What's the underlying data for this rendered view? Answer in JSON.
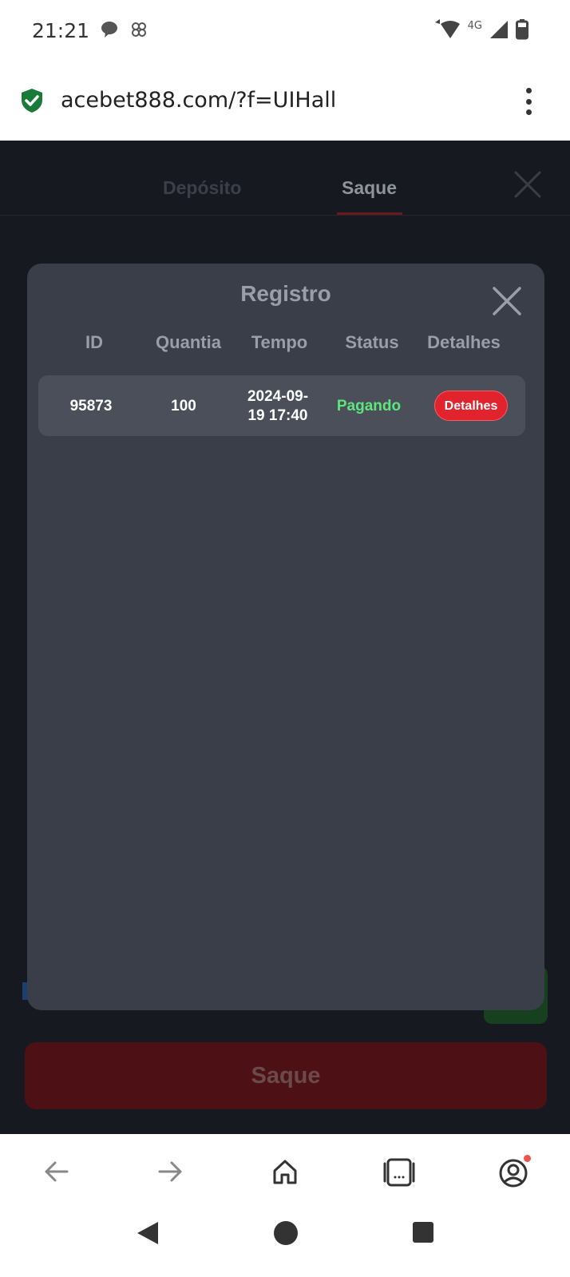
{
  "status_bar": {
    "time": "21:21",
    "network": "4G",
    "notification_icons": [
      "chat-bubble-icon",
      "app-icon"
    ],
    "system_icons": [
      "wifi-icon",
      "signal-icon",
      "battery-icon"
    ]
  },
  "browser": {
    "url": "acebet888.com/?f=UIHall",
    "secure": true
  },
  "page": {
    "tabs": [
      {
        "label": "Depósito",
        "active": false
      },
      {
        "label": "Saque",
        "active": true
      }
    ],
    "primary_button": "Saque"
  },
  "modal": {
    "title": "Registro",
    "columns": [
      "ID",
      "Quantia",
      "Tempo",
      "Status",
      "Detalhes"
    ],
    "rows": [
      {
        "id": "95873",
        "quantia": "100",
        "tempo_line1": "2024-09-",
        "tempo_line2": "19 17:40",
        "status": "Pagando",
        "detail_button": "Detalhes"
      }
    ]
  },
  "colors": {
    "page_bg": "#16191f",
    "modal_bg": "#393e48",
    "row_bg": "#4a4f59",
    "status_green": "#5ee57c",
    "accent_red": "#e0232d"
  },
  "bottom_bar_icons": [
    "back-arrow-icon",
    "forward-arrow-icon",
    "home-icon",
    "tabs-icon",
    "account-icon"
  ],
  "nav_icons": [
    "nav-back-icon",
    "nav-home-icon",
    "nav-recents-icon"
  ]
}
